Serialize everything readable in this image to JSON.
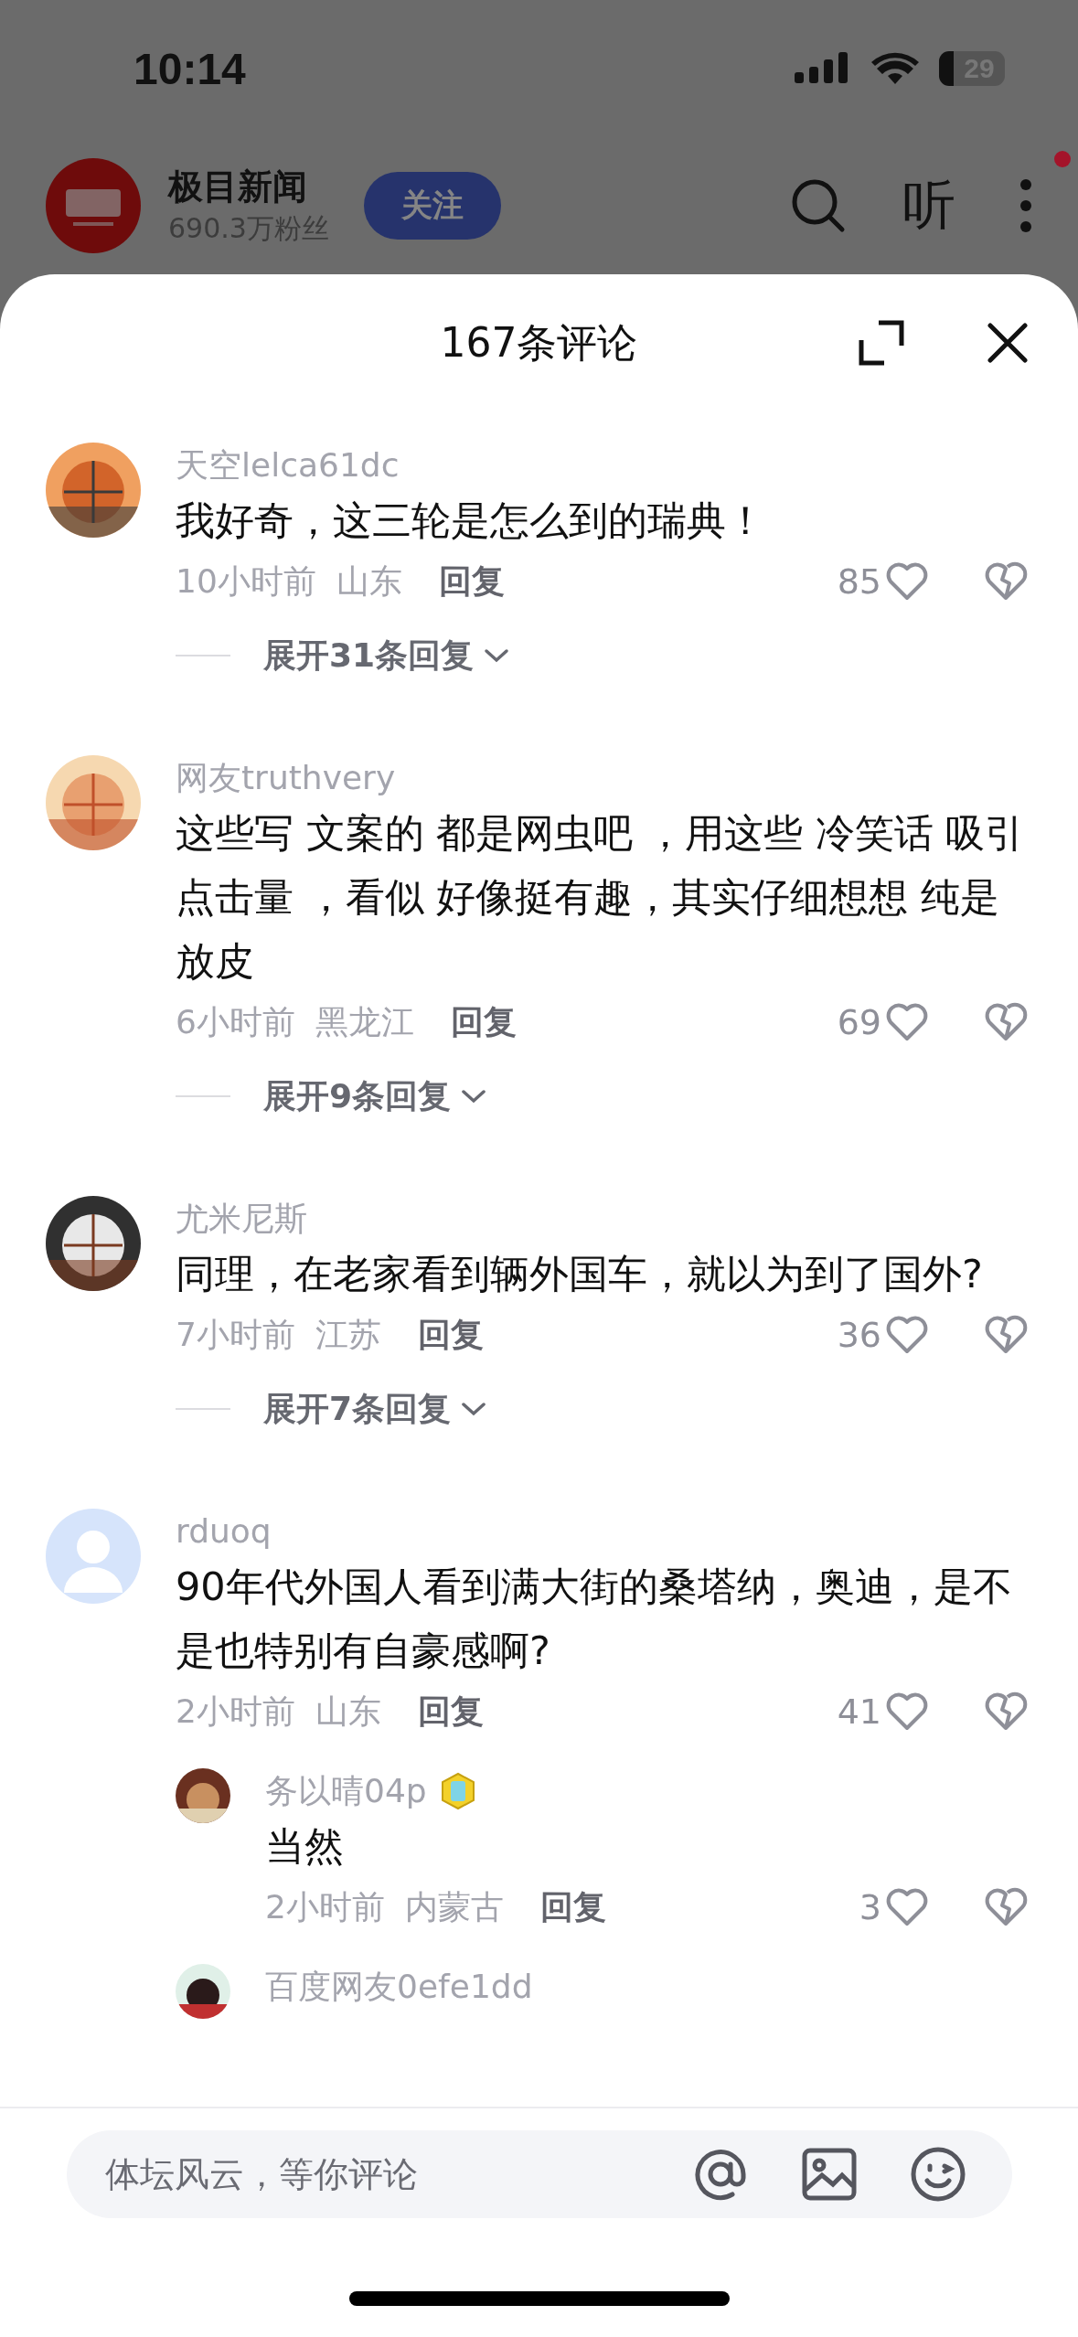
{
  "status_bar": {
    "time": "10:14",
    "battery": "29"
  },
  "account": {
    "name": "极目新闻",
    "followers": "690.3万粉丝",
    "follow_button": "关注",
    "listen_button": "听",
    "menu_badge": true
  },
  "comments_panel": {
    "title": "167条评论",
    "comments": [
      {
        "user": "天空lelca61dc",
        "text": "我好奇，这三轮是怎么到的瑞典！",
        "time": "10小时前",
        "location": "山东",
        "reply_label": "回复",
        "likes": "85",
        "expand": "展开31条回复"
      },
      {
        "user": "网友truthvery",
        "text": "这些写 文案的 都是网虫吧 ，用这些 冷笑话 吸引点击量 ，看似 好像挺有趣，其实仔细想想 纯是放皮",
        "time": "6小时前",
        "location": "黑龙江",
        "reply_label": "回复",
        "likes": "69",
        "expand": "展开9条回复"
      },
      {
        "user": "尤米尼斯",
        "text": "同理，在老家看到辆外国车，就以为到了国外?",
        "time": "7小时前",
        "location": "江苏",
        "reply_label": "回复",
        "likes": "36",
        "expand": "展开7条回复"
      },
      {
        "avatar": {
          "kind": "default"
        },
        "user": "rduoq",
        "text": "90年代外国人看到满大街的桑塔纳，奥迪，是不是也特别有自豪感啊?",
        "time": "2小时前",
        "location": "山东",
        "reply_label": "回复",
        "likes": "41",
        "replies": [
          {
            "user": "务以晴04p",
            "badge": true,
            "text": "当然",
            "time": "2小时前",
            "location": "内蒙古",
            "reply_label": "回复",
            "likes": "3"
          },
          {
            "user": "百度网友0efe1dd",
            "badge": false
          }
        ]
      }
    ],
    "input": {
      "placeholder": "体坛风云，等你评论"
    }
  }
}
